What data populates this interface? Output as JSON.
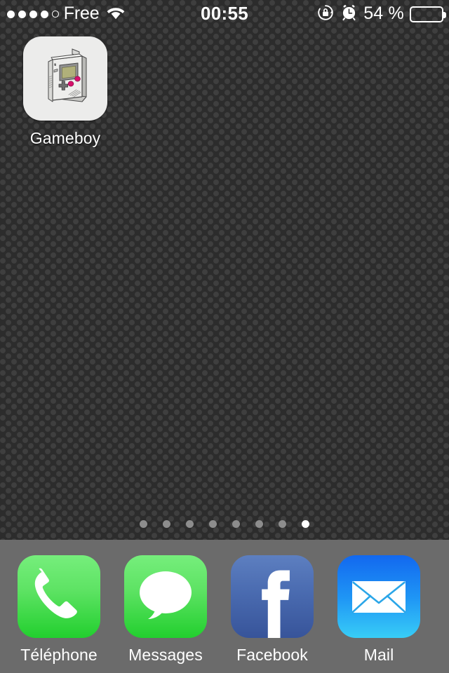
{
  "status_bar": {
    "signal_dots_total": 5,
    "signal_dots_filled": 4,
    "carrier": "Free",
    "wifi_icon": "wifi-icon",
    "time": "00:55",
    "rotation_lock_icon": "rotation-lock-icon",
    "alarm_icon": "alarm-clock-icon",
    "battery_percent_label": "54 %",
    "battery_level": 54,
    "battery_icon": "battery-icon"
  },
  "home_screen": {
    "apps": [
      {
        "label": "Gameboy",
        "icon": "gameboy-icon",
        "bg_color": "#ececeb"
      }
    ]
  },
  "page_dots": {
    "count": 8,
    "active_index": 7
  },
  "dock": {
    "background_color": "#6b6b6b",
    "items": [
      {
        "label": "Téléphone",
        "icon": "phone-icon",
        "icon_class": "ic-phone",
        "accent": "#5ee364"
      },
      {
        "label": "Messages",
        "icon": "speech-bubble-icon",
        "icon_class": "ic-messages",
        "accent": "#5ee364"
      },
      {
        "label": "Facebook",
        "icon": "facebook-f-icon",
        "icon_class": "ic-facebook",
        "accent": "#4a6bb0"
      },
      {
        "label": "Mail",
        "icon": "envelope-icon",
        "icon_class": "ic-mail",
        "accent": "#1f96f5"
      }
    ]
  },
  "wallpaper": {
    "base_color": "#2c2c2c",
    "dot_color": "#3f3f3f"
  }
}
